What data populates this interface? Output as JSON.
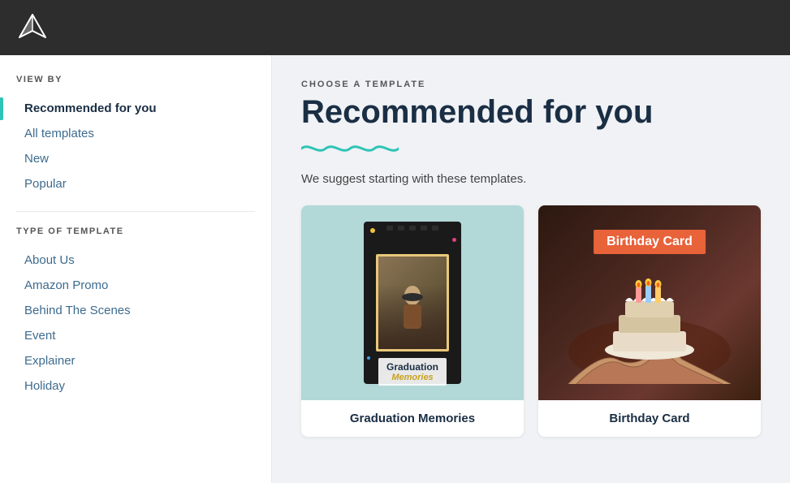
{
  "header": {
    "logo_alt": "App Logo"
  },
  "sidebar": {
    "view_by_label": "VIEW BY",
    "items_view": [
      {
        "id": "recommended",
        "label": "Recommended for you",
        "active": true
      },
      {
        "id": "all",
        "label": "All templates",
        "active": false
      },
      {
        "id": "new",
        "label": "New",
        "active": false
      },
      {
        "id": "popular",
        "label": "Popular",
        "active": false
      }
    ],
    "type_label": "TYPE OF TEMPLATE",
    "items_type": [
      {
        "id": "about-us",
        "label": "About Us"
      },
      {
        "id": "amazon-promo",
        "label": "Amazon Promo"
      },
      {
        "id": "behind-scenes",
        "label": "Behind The Scenes"
      },
      {
        "id": "event",
        "label": "Event"
      },
      {
        "id": "explainer",
        "label": "Explainer"
      },
      {
        "id": "holiday",
        "label": "Holiday"
      }
    ]
  },
  "main": {
    "choose_label": "CHOOSE A TEMPLATE",
    "title": "Recommended for you",
    "subtitle": "We suggest starting with these templates.",
    "cards": [
      {
        "id": "graduation",
        "label": "Graduation Memories",
        "text1": "Graduation",
        "text2": "Memories"
      },
      {
        "id": "birthday",
        "label": "Birthday Card",
        "overlay_text": "Birthday Card"
      }
    ]
  }
}
